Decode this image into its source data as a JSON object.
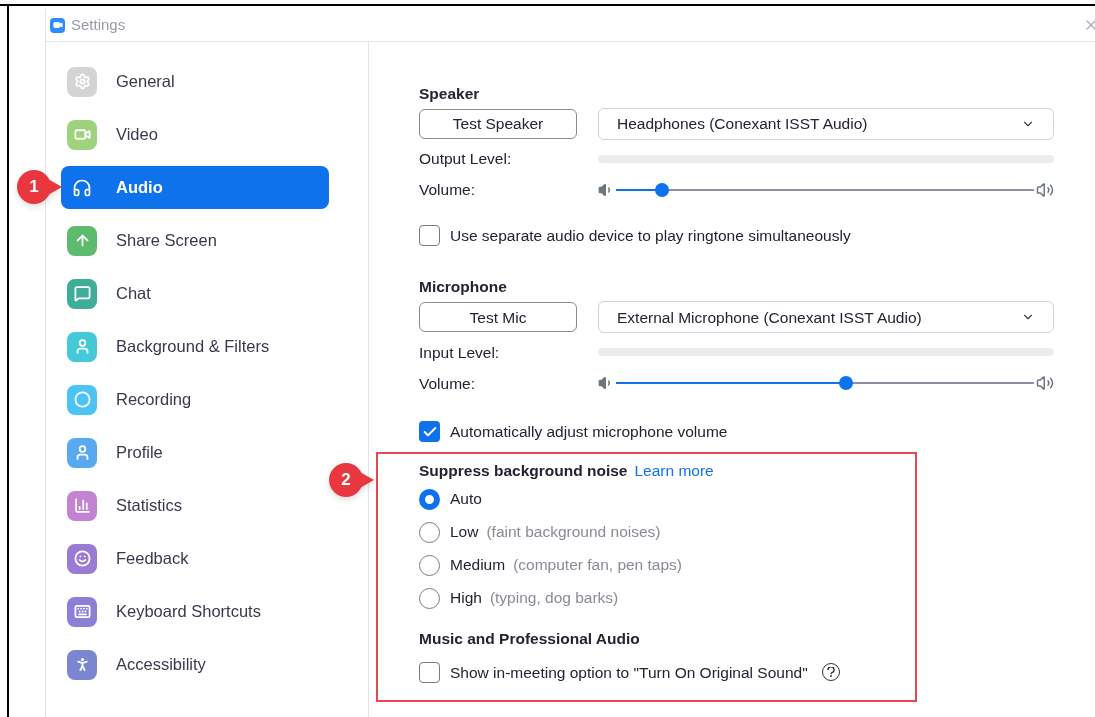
{
  "window": {
    "title": "Settings"
  },
  "sidebar": {
    "items": [
      {
        "label": "General",
        "selected": false,
        "color": "#d4d4d4"
      },
      {
        "label": "Video",
        "selected": false,
        "color": "#9fd27c"
      },
      {
        "label": "Audio",
        "selected": true
      },
      {
        "label": "Share Screen",
        "selected": false,
        "color": "#5cbb6c"
      },
      {
        "label": "Chat",
        "selected": false,
        "color": "#3eae98"
      },
      {
        "label": "Background & Filters",
        "selected": false,
        "color": "#45c8d8"
      },
      {
        "label": "Recording",
        "selected": false,
        "color": "#4cc3f5"
      },
      {
        "label": "Profile",
        "selected": false,
        "color": "#58a9ef"
      },
      {
        "label": "Statistics",
        "selected": false,
        "color": "#c283d3"
      },
      {
        "label": "Feedback",
        "selected": false,
        "color": "#9a7bd3"
      },
      {
        "label": "Keyboard Shortcuts",
        "selected": false,
        "color": "#8b80d6"
      },
      {
        "label": "Accessibility",
        "selected": false,
        "color": "#7a86cf"
      }
    ]
  },
  "speaker": {
    "heading": "Speaker",
    "test_button": "Test Speaker",
    "device": "Headphones (Conexant ISST Audio)",
    "level_label": "Output Level:",
    "output_level": {
      "level": 0
    },
    "volume_label": "Volume:",
    "volume": {
      "level": 0.11
    }
  },
  "ringtone_option": {
    "label": "Use separate audio device to play ringtone simultaneously",
    "checked": false
  },
  "microphone": {
    "heading": "Microphone",
    "test_button": "Test Mic",
    "device": "External Microphone (Conexant ISST Audio)",
    "level_label": "Input Level:",
    "input_level": {
      "level": 0
    },
    "volume_label": "Volume:",
    "volume": {
      "level": 0.55
    }
  },
  "auto_adjust_option": {
    "label": "Automatically adjust microphone volume",
    "checked": true
  },
  "suppress_noise": {
    "heading": "Suppress background noise",
    "link": "Learn more",
    "options": [
      {
        "label": "Auto",
        "selected": true
      },
      {
        "label": "Low",
        "hint": "(faint background noises)",
        "selected": false
      },
      {
        "label": "Medium",
        "hint": "(computer fan, pen taps)",
        "selected": false
      },
      {
        "label": "High",
        "hint": "(typing, dog barks)",
        "selected": false
      }
    ]
  },
  "professional_audio": {
    "heading": "Music and Professional Audio",
    "option": {
      "label": "Show in-meeting option to \"Turn On Original Sound\"",
      "checked": false
    }
  },
  "callouts": [
    {
      "label": "1"
    },
    {
      "label": "2"
    }
  ]
}
